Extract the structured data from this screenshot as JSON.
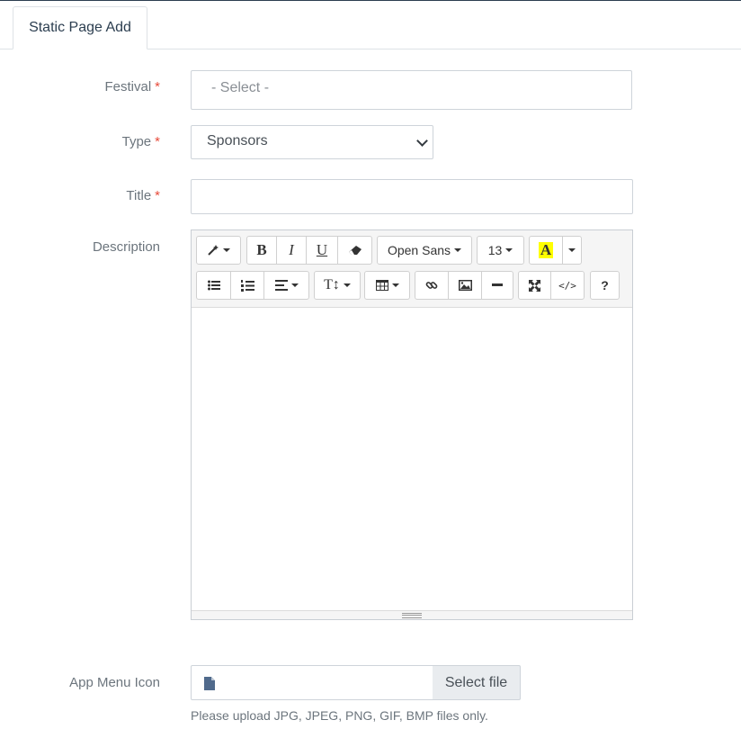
{
  "tab": {
    "label": "Static Page Add"
  },
  "form": {
    "festival": {
      "label": "Festival",
      "required": "*",
      "value": "- Select -"
    },
    "type": {
      "label": "Type",
      "required": "*",
      "value": "Sponsors"
    },
    "title": {
      "label": "Title",
      "required": "*",
      "value": ""
    },
    "description": {
      "label": "Description"
    },
    "app_menu_icon": {
      "label": "App Menu Icon",
      "button": "Select file",
      "help": "Please upload JPG, JPEG, PNG, GIF, BMP files only."
    }
  },
  "editor": {
    "font_name": "Open Sans",
    "font_size": "13",
    "bold": "B",
    "italic": "I",
    "underline": "U",
    "color_glyph": "A",
    "help": "?",
    "colors": {
      "highlight": "#ffff00"
    },
    "icons": [
      "magic-icon",
      "bold-icon",
      "italic-icon",
      "underline-icon",
      "eraser-icon",
      "unordered-list-icon",
      "ordered-list-icon",
      "paragraph-align-icon",
      "line-height-icon",
      "table-icon",
      "link-icon",
      "picture-icon",
      "horizontal-rule-icon",
      "fullscreen-icon",
      "code-view-icon",
      "help-icon"
    ]
  }
}
